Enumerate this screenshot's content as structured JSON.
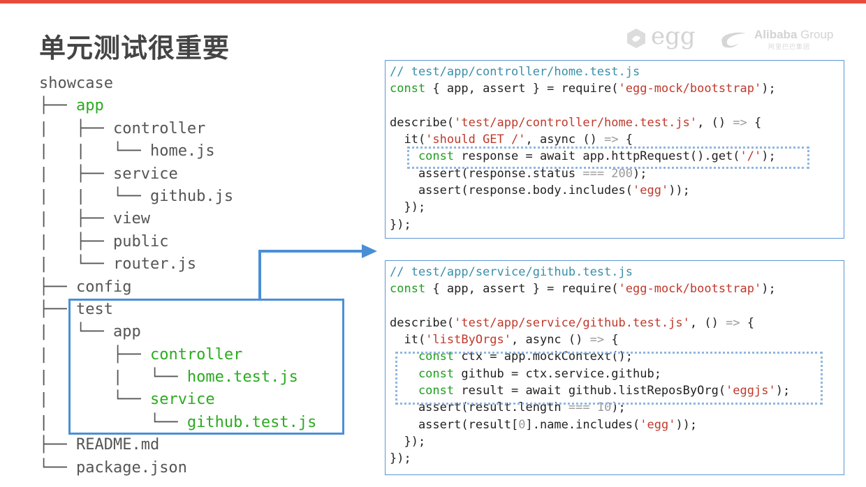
{
  "title": "单元测试很重要",
  "logos": {
    "egg_text": "egg",
    "alibaba_brand": "Alibaba",
    "alibaba_group": "Group",
    "alibaba_sub": "阿里巴巴集团",
    "icons": [
      "egg-logo-icon",
      "alibaba-logo-icon"
    ]
  },
  "colors": {
    "accent_bar": "#e84a3c",
    "highlight_border": "#4a8fd6",
    "green": "#2bab20",
    "string": "#c0392b",
    "comment": "#3a8fa8"
  },
  "tree": [
    {
      "prefix": "",
      "name": "showcase",
      "green": false
    },
    {
      "prefix": "├── ",
      "name": "app",
      "green": true
    },
    {
      "prefix": "|   ├── ",
      "name": "controller",
      "green": false
    },
    {
      "prefix": "|   |   └── ",
      "name": "home.js",
      "green": false
    },
    {
      "prefix": "|   ├── ",
      "name": "service",
      "green": false
    },
    {
      "prefix": "|   |   └── ",
      "name": "github.js",
      "green": false
    },
    {
      "prefix": "|   ├── ",
      "name": "view",
      "green": false
    },
    {
      "prefix": "|   ├── ",
      "name": "public",
      "green": false
    },
    {
      "prefix": "|   └── ",
      "name": "router.js",
      "green": false
    },
    {
      "prefix": "├── ",
      "name": "config",
      "green": false
    },
    {
      "prefix": "├── ",
      "name": "test",
      "green": false
    },
    {
      "prefix": "|   └── ",
      "name": "app",
      "green": false
    },
    {
      "prefix": "|       ├── ",
      "name": "controller",
      "green": true
    },
    {
      "prefix": "|       |   └── ",
      "name": "home.test.js",
      "green": true
    },
    {
      "prefix": "|       └── ",
      "name": "service",
      "green": true
    },
    {
      "prefix": "|           └── ",
      "name": "github.test.js",
      "green": true
    },
    {
      "prefix": "├── ",
      "name": "README.md",
      "green": false
    },
    {
      "prefix": "└── ",
      "name": "package.json",
      "green": false
    }
  ],
  "code_controller": [
    [
      [
        "c",
        "// test/app/controller/home.test.js"
      ]
    ],
    [
      [
        "k",
        "const"
      ],
      [
        "p",
        " { app, assert } = require("
      ],
      [
        "s",
        "'egg-mock/bootstrap'"
      ],
      [
        "p",
        ");"
      ]
    ],
    [
      [
        "p",
        " "
      ]
    ],
    [
      [
        "p",
        "describe("
      ],
      [
        "s",
        "'test/app/controller/home.test.js'"
      ],
      [
        "p",
        ", () "
      ],
      [
        "o",
        "=>"
      ],
      [
        "p",
        " {"
      ]
    ],
    [
      [
        "p",
        "  it("
      ],
      [
        "s",
        "'should GET /'"
      ],
      [
        "p",
        ", async () "
      ],
      [
        "o",
        "=>"
      ],
      [
        "p",
        " {"
      ]
    ],
    [
      [
        "k",
        "    const"
      ],
      [
        "p",
        " response = await app.httpRequest().get("
      ],
      [
        "s",
        "'/'"
      ],
      [
        "p",
        ");"
      ]
    ],
    [
      [
        "p",
        "    assert(response.status "
      ],
      [
        "o",
        "==="
      ],
      [
        "n",
        " 200"
      ],
      [
        "p",
        ");"
      ]
    ],
    [
      [
        "p",
        "    assert(response.body.includes("
      ],
      [
        "s",
        "'egg'"
      ],
      [
        "p",
        "));"
      ]
    ],
    [
      [
        "p",
        "  });"
      ]
    ],
    [
      [
        "p",
        "});"
      ]
    ]
  ],
  "code_service": [
    [
      [
        "c",
        "// test/app/service/github.test.js"
      ]
    ],
    [
      [
        "k",
        "const"
      ],
      [
        "p",
        " { app, assert } = require("
      ],
      [
        "s",
        "'egg-mock/bootstrap'"
      ],
      [
        "p",
        ");"
      ]
    ],
    [
      [
        "p",
        " "
      ]
    ],
    [
      [
        "p",
        "describe("
      ],
      [
        "s",
        "'test/app/service/github.test.js'"
      ],
      [
        "p",
        ", () "
      ],
      [
        "o",
        "=>"
      ],
      [
        "p",
        " {"
      ]
    ],
    [
      [
        "p",
        "  it("
      ],
      [
        "s",
        "'listByOrgs'"
      ],
      [
        "p",
        ", async () "
      ],
      [
        "o",
        "=>"
      ],
      [
        "p",
        " {"
      ]
    ],
    [
      [
        "k",
        "    const"
      ],
      [
        "p",
        " ctx = app.mockContext();"
      ]
    ],
    [
      [
        "k",
        "    const"
      ],
      [
        "p",
        " github = ctx.service.github;"
      ]
    ],
    [
      [
        "k",
        "    const"
      ],
      [
        "p",
        " result = await github.listReposByOrg("
      ],
      [
        "s",
        "'eggjs'"
      ],
      [
        "p",
        ");"
      ]
    ],
    [
      [
        "p",
        "    assert(result.length "
      ],
      [
        "o",
        "==="
      ],
      [
        "n",
        " 10"
      ],
      [
        "p",
        ");"
      ]
    ],
    [
      [
        "p",
        "    assert(result["
      ],
      [
        "n",
        "0"
      ],
      [
        "p",
        "].name.includes("
      ],
      [
        "s",
        "'egg'"
      ],
      [
        "p",
        "));"
      ]
    ],
    [
      [
        "p",
        "  });"
      ]
    ],
    [
      [
        "p",
        "});"
      ]
    ]
  ]
}
